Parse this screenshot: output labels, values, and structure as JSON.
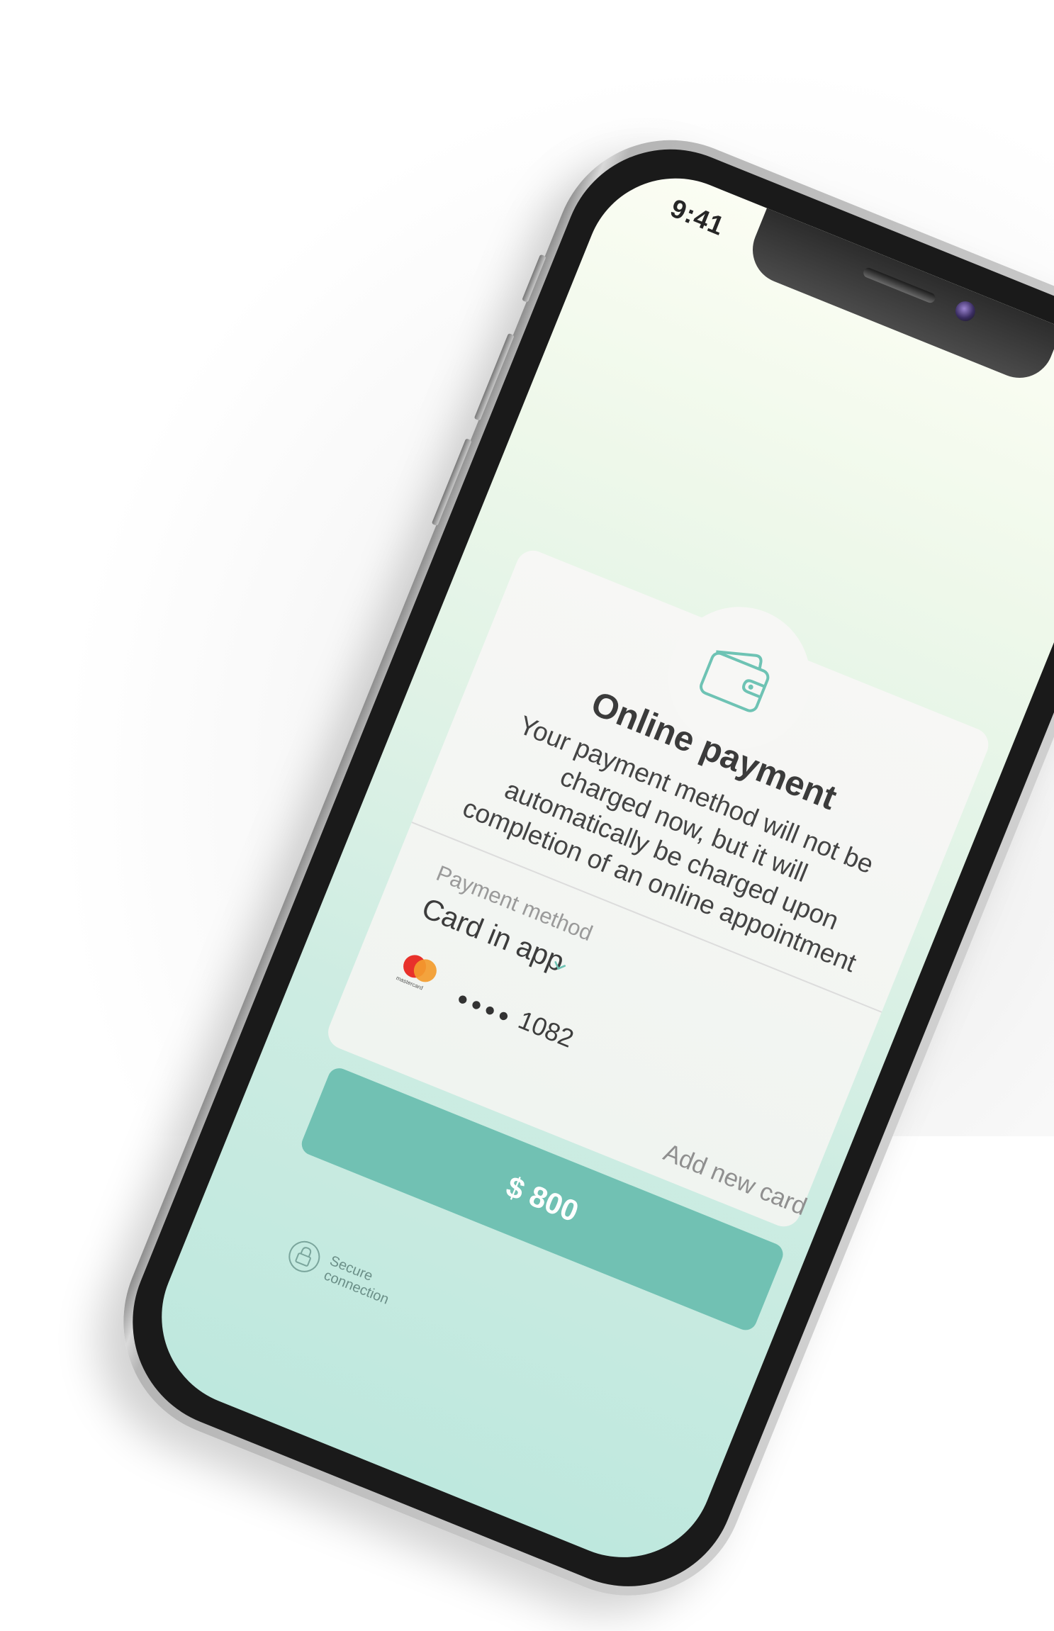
{
  "status_bar": {
    "time": "9:41"
  },
  "payment": {
    "title": "Online payment",
    "description": "Your payment method will not be charged now, but it will automatically be charged upon completion of an online appointment",
    "method_label": "Payment method",
    "method_value": "Card in app",
    "card_brand": "mastercard",
    "card_mask": "••••",
    "card_last4": "1082",
    "add_card_label": "Add new card",
    "pay_button_label": "$ 800"
  },
  "footer": {
    "secure_label": "Secure connection"
  },
  "colors": {
    "accent": "#71c1b3",
    "icon_stroke": "#6ec3b4",
    "title_text": "#3b3b3b",
    "muted_text": "#9a9a9a"
  },
  "icons": {
    "wallet": "wallet-icon",
    "chevron": "chevron-down-icon",
    "lock": "lock-icon"
  }
}
